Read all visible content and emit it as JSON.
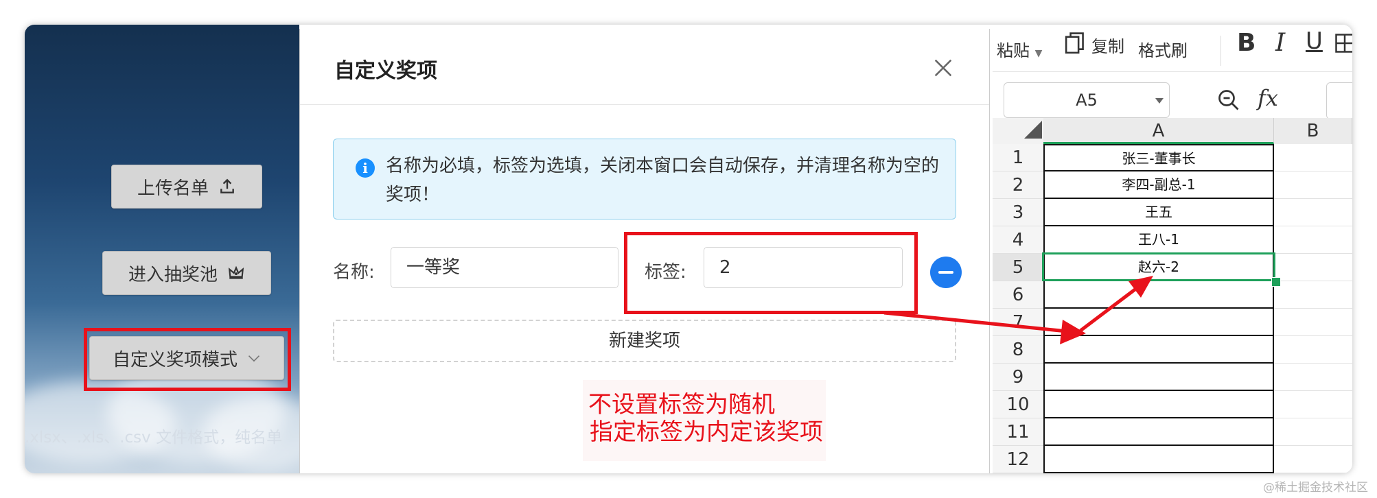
{
  "left_app": {
    "upload_label": "上传名单",
    "enter_pool_label": "进入抽奖池",
    "mode_label": "自定义奖项模式",
    "file_hint": ".xlsx、.xls、.csv 文件格式，纯名单"
  },
  "dialog": {
    "title": "自定义奖项",
    "alert": "名称为必填，标签为选填，关闭本窗口会自动保存，并清理名称为空的奖项！",
    "name_label": "名称:",
    "name_value": "一等奖",
    "tag_label": "标签:",
    "tag_value": "2",
    "new_award_label": "新建奖项",
    "note_line1": "不设置标签为随机",
    "note_line2": "指定标签为内定该奖项"
  },
  "spreadsheet": {
    "toolbar": {
      "paste_label": "粘贴",
      "copy_label": "复制",
      "format_painter_label": "格式刷"
    },
    "name_box": "A5",
    "fx_label": "fx",
    "col_headers": [
      "A",
      "B"
    ],
    "rows": [
      {
        "num": "1",
        "a": "张三-董事长"
      },
      {
        "num": "2",
        "a": "李四-副总-1"
      },
      {
        "num": "3",
        "a": "王五"
      },
      {
        "num": "4",
        "a": "王八-1"
      },
      {
        "num": "5",
        "a": "赵六-2"
      },
      {
        "num": "6",
        "a": ""
      },
      {
        "num": "7",
        "a": ""
      },
      {
        "num": "8",
        "a": ""
      },
      {
        "num": "9",
        "a": ""
      },
      {
        "num": "10",
        "a": ""
      },
      {
        "num": "11",
        "a": ""
      },
      {
        "num": "12",
        "a": ""
      }
    ],
    "selected_cell": "A5"
  },
  "colors": {
    "annotation_red": "#e8121b",
    "primary_blue": "#1e7bef",
    "selection_green": "#1ea05a"
  },
  "watermark": "@稀土掘金技术社区"
}
